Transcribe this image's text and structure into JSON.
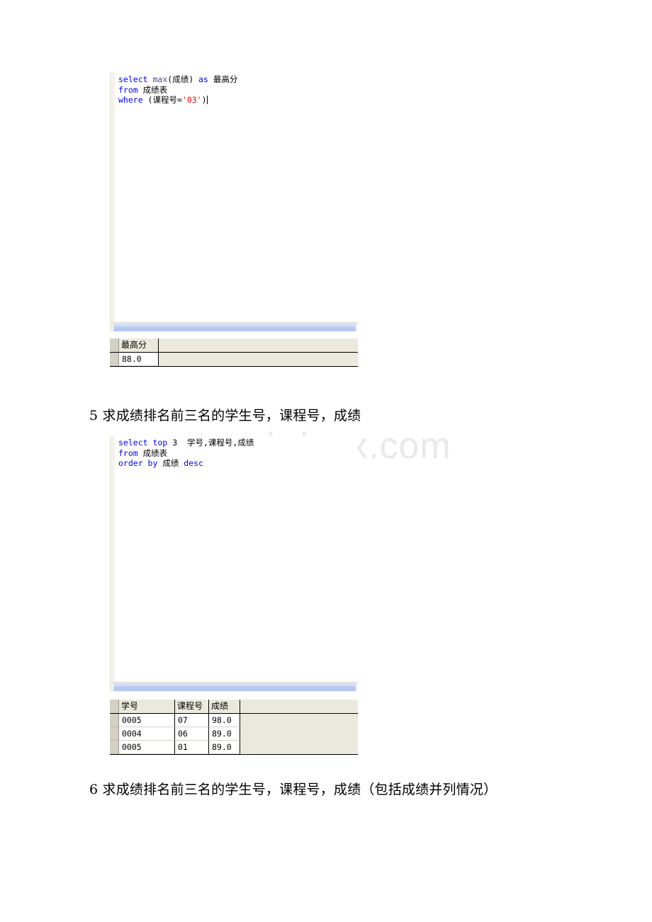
{
  "document": {
    "watermark": "www.bdocx.com",
    "paragraphs": [
      {
        "id": "q5",
        "text": "5 求成绩排名前三名的学生号，课程号，成绩"
      },
      {
        "id": "q6",
        "text": "6 求成绩排名前三名的学生号，课程号，成绩（包括成绩并列情况）"
      }
    ]
  },
  "blocks": [
    {
      "id": "block-1",
      "editor": {
        "lines": [
          {
            "tokens": [
              {
                "t": "select",
                "c": "kw"
              },
              {
                "t": " ",
                "c": "plain"
              },
              {
                "t": "max",
                "c": "fn"
              },
              {
                "t": "(成绩) ",
                "c": "plain"
              },
              {
                "t": "as",
                "c": "kw"
              },
              {
                "t": " 最高分",
                "c": "plain"
              }
            ]
          },
          {
            "tokens": [
              {
                "t": "from",
                "c": "kw"
              },
              {
                "t": " 成绩表",
                "c": "plain"
              }
            ]
          },
          {
            "tokens": [
              {
                "t": "where",
                "c": "kw"
              },
              {
                "t": " (课程号=",
                "c": "plain"
              },
              {
                "t": "'03'",
                "c": "str"
              },
              {
                "t": ")",
                "c": "plain"
              }
            ],
            "cursor": true
          }
        ]
      },
      "results": {
        "columns": [
          "最高分"
        ],
        "rows": [
          [
            "88.0"
          ]
        ]
      }
    },
    {
      "id": "block-2",
      "editor": {
        "lines": [
          {
            "tokens": [
              {
                "t": "select top",
                "c": "kw"
              },
              {
                "t": " ",
                "c": "plain"
              },
              {
                "t": "3",
                "c": "num"
              },
              {
                "t": "  学号,课程号,成绩",
                "c": "plain"
              }
            ]
          },
          {
            "tokens": [
              {
                "t": "from",
                "c": "kw"
              },
              {
                "t": " 成绩表",
                "c": "plain"
              }
            ]
          },
          {
            "tokens": [
              {
                "t": "order by",
                "c": "kw"
              },
              {
                "t": " 成绩 ",
                "c": "plain"
              },
              {
                "t": "desc",
                "c": "kw"
              }
            ]
          }
        ]
      },
      "results": {
        "columns": [
          "学号",
          "课程号",
          "成绩"
        ],
        "rows": [
          [
            "0005",
            "07",
            "98.0"
          ],
          [
            "0004",
            "06",
            "89.0"
          ],
          [
            "0005",
            "01",
            "89.0"
          ]
        ]
      }
    }
  ],
  "colors": {
    "keyword": "#0000ff",
    "function": "#4b4b8f",
    "string": "#ff0000",
    "scrollbar_thumb": "#bccdf3",
    "grid_background": "#ebe8dd",
    "row_header": "#d4d0c4",
    "watermark": "#e9e9e9"
  }
}
